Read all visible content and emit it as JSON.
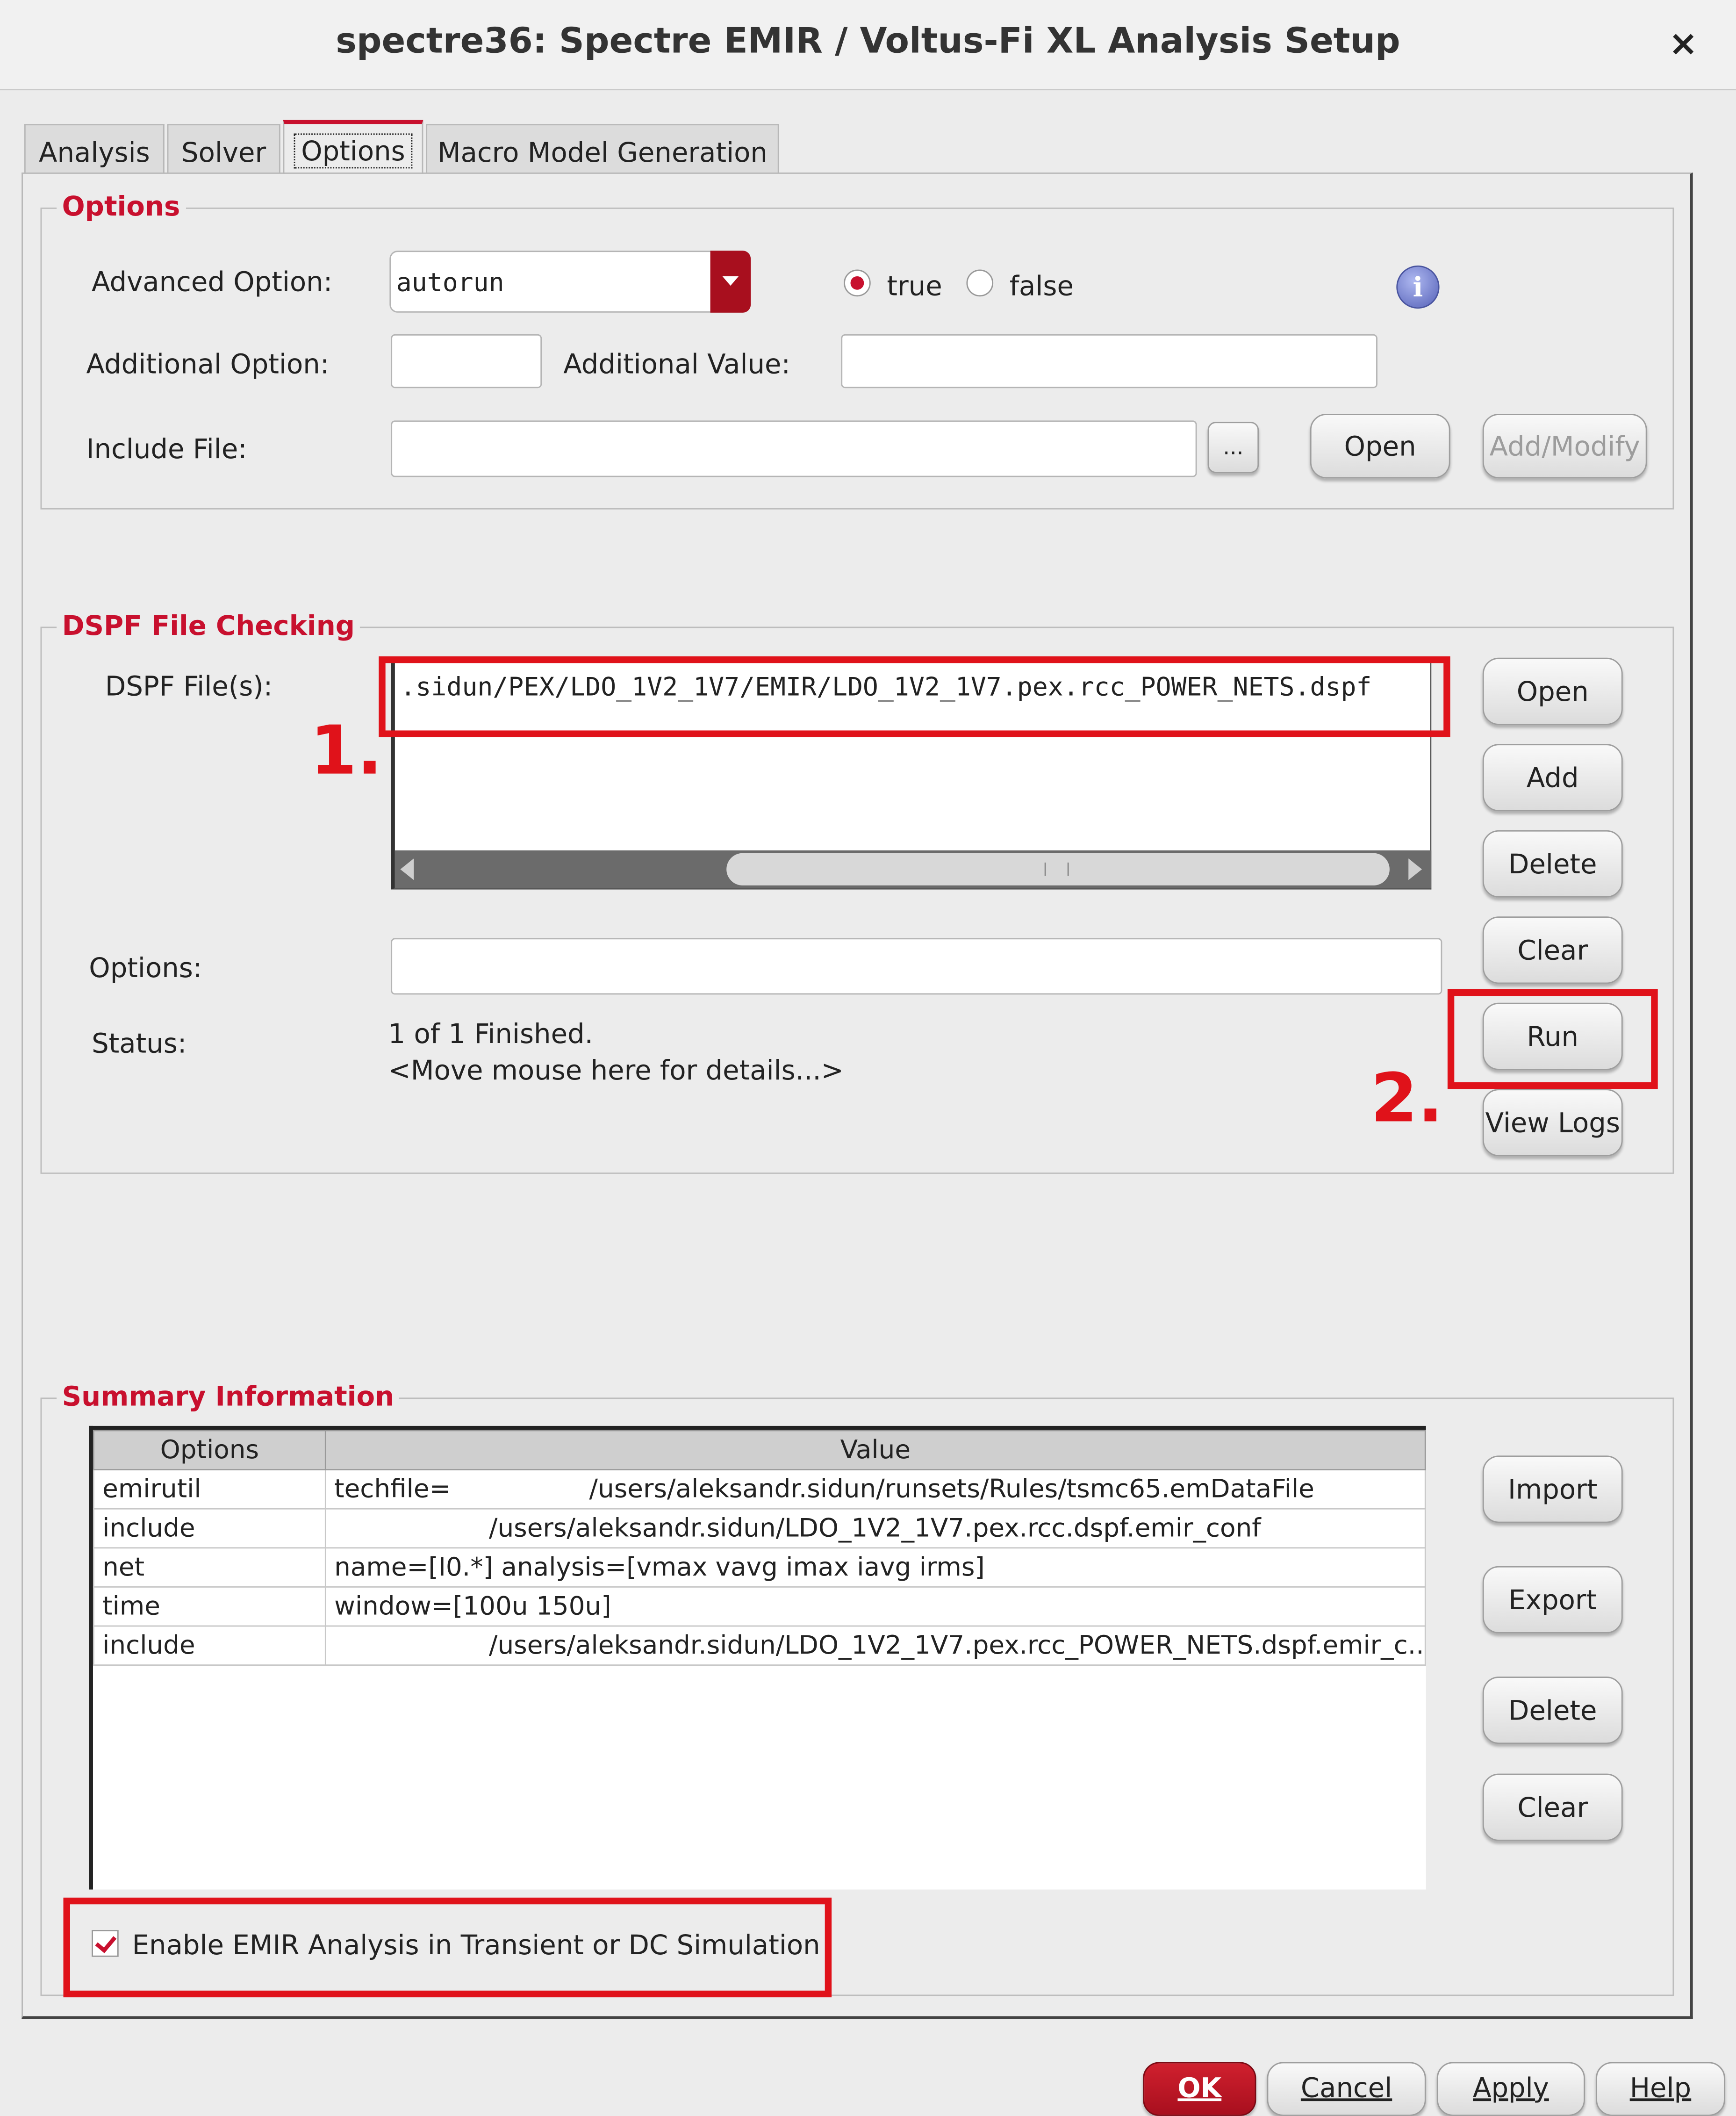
{
  "window": {
    "title": "spectre36: Spectre EMIR / Voltus-Fi XL Analysis Setup",
    "close": "×"
  },
  "tabs": [
    "Analysis",
    "Solver",
    "Options",
    "Macro Model Generation"
  ],
  "options_group": {
    "title": "Options",
    "advanced_label": "Advanced Option:",
    "advanced_value": "autorun",
    "radio_true": "true",
    "radio_false": "false",
    "radio_selected": "true",
    "info_icon": "i",
    "additional_option_label": "Additional Option:",
    "additional_value_label": "Additional Value:",
    "include_file_label": "Include File:",
    "browse": "...",
    "open": "Open",
    "add_modify": "Add/Modify"
  },
  "dspf_group": {
    "title": "DSPF File Checking",
    "files_label": "DSPF File(s):",
    "files": [
      ".sidun/PEX/LDO_1V2_1V7/EMIR/LDO_1V2_1V7.pex.rcc_POWER_NETS.dspf"
    ],
    "options_label": "Options:",
    "status_label": "Status:",
    "status_text": "1 of 1 Finished.",
    "status_hint": "<Move mouse here for details...>",
    "buttons": {
      "open": "Open",
      "add": "Add",
      "delete": "Delete",
      "clear": "Clear",
      "run": "Run",
      "view_logs": "View Logs"
    }
  },
  "summary_group": {
    "title": "Summary Information",
    "columns": [
      "Options",
      "Value"
    ],
    "rows": [
      [
        "emirutil",
        "techfile=                 /users/aleksandr.sidun/runsets/Rules/tsmc65.emDataFile"
      ],
      [
        "include",
        "                   /users/aleksandr.sidun/LDO_1V2_1V7.pex.rcc.dspf.emir_conf"
      ],
      [
        "net",
        "name=[I0.*] analysis=[vmax vavg imax iavg irms]"
      ],
      [
        "time",
        "window=[100u 150u]"
      ],
      [
        "include",
        "                   /users/aleksandr.sidun/LDO_1V2_1V7.pex.rcc_POWER_NETS.dspf.emir_c..."
      ]
    ],
    "buttons": {
      "import": "Import",
      "export": "Export",
      "delete": "Delete",
      "clear": "Clear"
    },
    "enable_label": "Enable EMIR Analysis in Transient or DC Simulation",
    "enable_checked": true
  },
  "annotations": [
    "1.",
    "2."
  ],
  "footer": {
    "ok": "OK",
    "cancel": "Cancel",
    "apply": "Apply",
    "help": "Help"
  },
  "colors": {
    "accent": "#c8102e",
    "annotation": "#e0121a"
  }
}
